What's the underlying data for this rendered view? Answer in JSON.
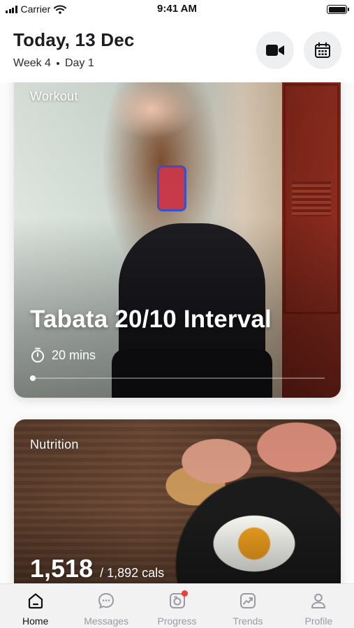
{
  "status_bar": {
    "carrier": "Carrier",
    "time": "9:41 AM"
  },
  "header": {
    "date": "Today, 13 Dec",
    "week": "Week 4",
    "day": "Day 1",
    "video_icon": "video-camera-icon",
    "calendar_icon": "calendar-icon"
  },
  "workout": {
    "label": "Workout",
    "title": "Tabata 20/10 Interval",
    "duration": "20 mins",
    "progress": 0.01
  },
  "nutrition": {
    "label": "Nutrition",
    "calories": "1,518",
    "calories_total": "/ 1,892 cals"
  },
  "tabs": [
    {
      "label": "Home",
      "icon": "home-icon",
      "active": true
    },
    {
      "label": "Messages",
      "icon": "messages-icon",
      "active": false
    },
    {
      "label": "Progress",
      "icon": "progress-camera-icon",
      "active": false,
      "badge": true
    },
    {
      "label": "Trends",
      "icon": "trends-icon",
      "active": false
    },
    {
      "label": "Profile",
      "icon": "profile-icon",
      "active": false
    }
  ],
  "colors": {
    "accent": "#111111",
    "inactive": "#9a9aa2",
    "badge": "#ef3b3b"
  }
}
